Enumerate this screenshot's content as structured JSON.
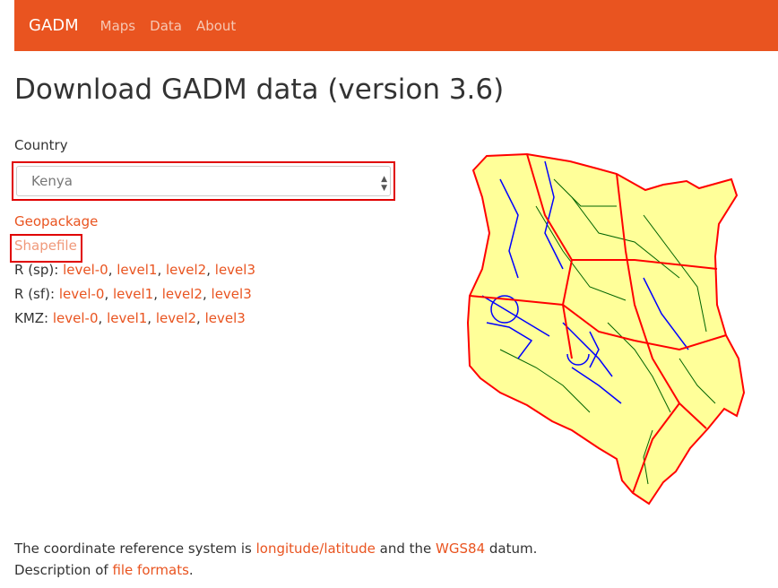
{
  "navbar": {
    "brand": "GADM",
    "links": [
      "Maps",
      "Data",
      "About"
    ],
    "color": "#e95420"
  },
  "page": {
    "title": "Download GADM data (version 3.6)"
  },
  "country": {
    "label": "Country",
    "selected": "Kenya"
  },
  "downloads": {
    "geopackage": "Geopackage",
    "shapefile": "Shapefile",
    "r_sp": {
      "label": "R (sp):",
      "links": [
        "level-0",
        "level1",
        "level2",
        "level3"
      ]
    },
    "r_sf": {
      "label": "R (sf):",
      "links": [
        "level-0",
        "level1",
        "level2",
        "level3"
      ]
    },
    "kmz": {
      "label": "KMZ:",
      "links": [
        "level-0",
        "level1",
        "level2",
        "level3"
      ]
    }
  },
  "footer": {
    "crs_prefix": "The coordinate reference system is",
    "crs_link": "longitude/latitude",
    "crs_mid": "and the",
    "datum_link": "WGS84",
    "crs_suffix": "datum.",
    "desc_prefix": "Description of",
    "formats_link": "file formats",
    "desc_suffix": "."
  },
  "map": {
    "fill_color": "#ffff99",
    "level1_color": "#ff0000",
    "level2_color": "#0000ff",
    "level3_color": "#006400"
  }
}
